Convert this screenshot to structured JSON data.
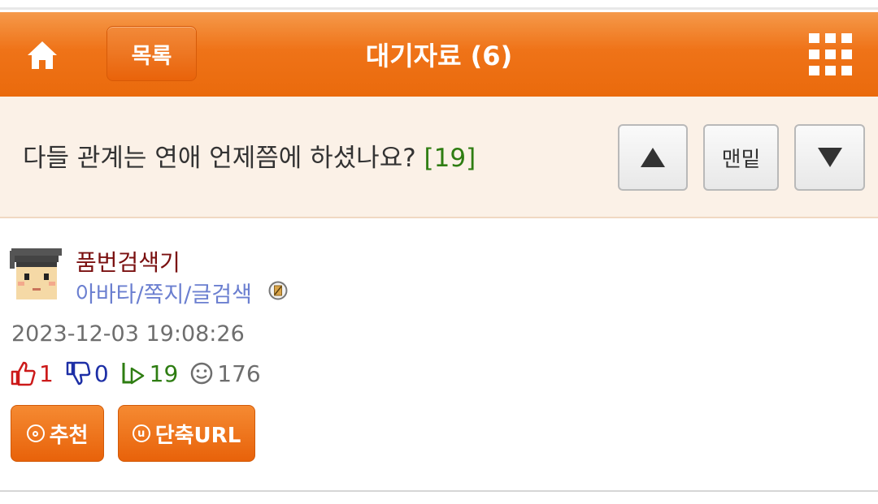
{
  "header": {
    "list_label": "목록",
    "title": "대기자료 (6)"
  },
  "post": {
    "title": "다들 관계는 연애 언제쯤에 하셨나요?",
    "comment_count": "[19]"
  },
  "nav": {
    "bottom_label": "맨밑"
  },
  "author": {
    "name": "품번검색기",
    "links": "아바타/쪽지/글검색"
  },
  "datetime": "2023-12-03 19:08:26",
  "stats": {
    "upvotes": "1",
    "downvotes": "0",
    "replies": "19",
    "views": "176"
  },
  "actions": {
    "recommend_label": "추천",
    "shorturl_label": "단축URL"
  },
  "colors": {
    "accent": "#ef7318",
    "comment_count": "#2e7d12",
    "author_name": "#7a1010",
    "author_links": "#6b7fd0"
  }
}
